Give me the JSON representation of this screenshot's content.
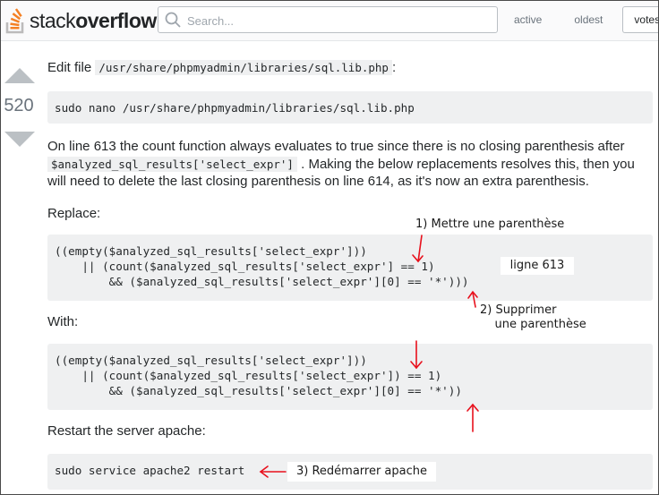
{
  "header": {
    "logo_light": "stack",
    "logo_bold": "overflow",
    "search_placeholder": "Search...",
    "tabs": [
      {
        "label": "active"
      },
      {
        "label": "oldest"
      },
      {
        "label": "votes",
        "selected": true
      }
    ]
  },
  "vote": {
    "count": "520"
  },
  "post": {
    "edit_prefix": "Edit file ",
    "edit_path": "/usr/share/phpmyadmin/libraries/sql.lib.php",
    "edit_suffix": ":",
    "cmd1": "sudo nano /usr/share/phpmyadmin/libraries/sql.lib.php",
    "line613_a": "On line 613 the count function always evaluates to true since there is no closing parenthesis after",
    "line613_code": "$analyzed_sql_results['select_expr']",
    "line613_b": ". Making the below replacements resolves this, then you",
    "line613_c": "will need to delete the last closing parenthesis on line 614, as it's now an extra parenthesis.",
    "replace_label": "Replace:",
    "replace_code": [
      "((empty($analyzed_sql_results['select_expr']))",
      "    || (count($analyzed_sql_results['select_expr'] == 1)",
      "        && ($analyzed_sql_results['select_expr'][0] == '*')))"
    ],
    "with_label": "With:",
    "with_code": [
      "((empty($analyzed_sql_results['select_expr']))",
      "    || (count($analyzed_sql_results['select_expr']) == 1)",
      "        && ($analyzed_sql_results['select_expr'][0] == '*'))"
    ],
    "restart_label": "Restart the server apache:",
    "cmd2": "sudo service apache2 restart"
  },
  "annotations": {
    "a1": "1) Mettre une parenthèse",
    "a_line": "ligne 613",
    "a2": "2) Supprimer\n    une parenthèse",
    "a3": "3) Redémarrer apache",
    "arrow_color": "#e8101c"
  }
}
